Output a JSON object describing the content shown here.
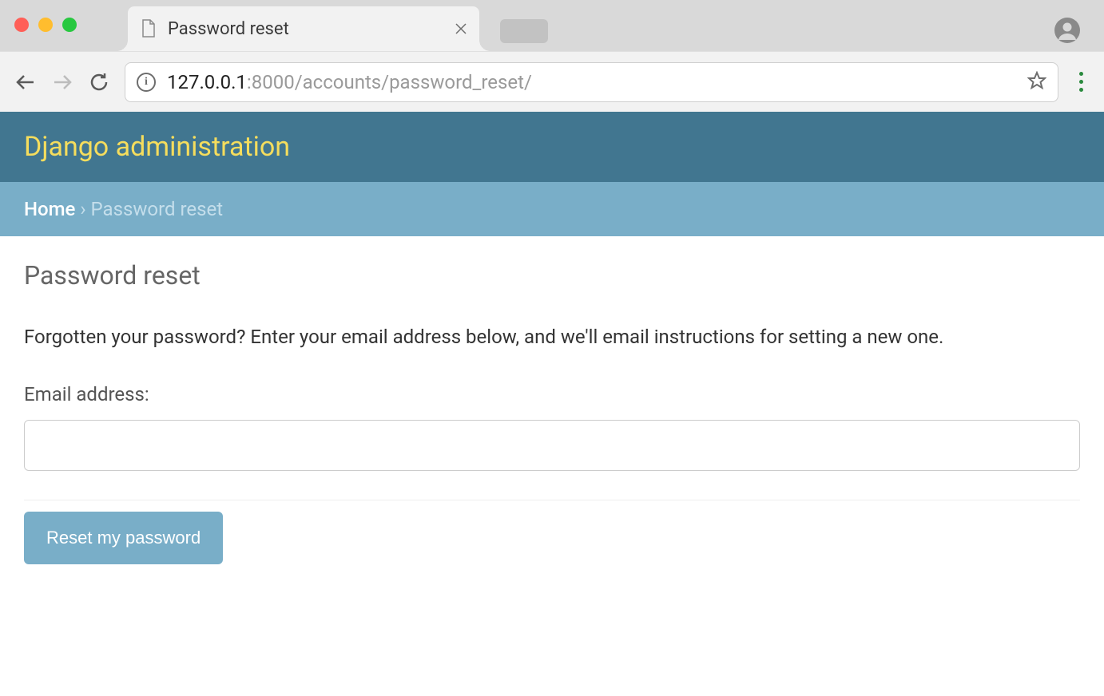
{
  "browser": {
    "tab_title": "Password reset",
    "url_host": "127.0.0.1",
    "url_path": ":8000/accounts/password_reset/"
  },
  "header": {
    "title": "Django administration"
  },
  "breadcrumb": {
    "home": "Home",
    "separator": " › ",
    "current": "Password reset"
  },
  "page": {
    "heading": "Password reset",
    "description": "Forgotten your password? Enter your email address below, and we'll email instructions for setting a new one.",
    "email_label": "Email address:",
    "email_value": "",
    "submit_label": "Reset my password"
  }
}
